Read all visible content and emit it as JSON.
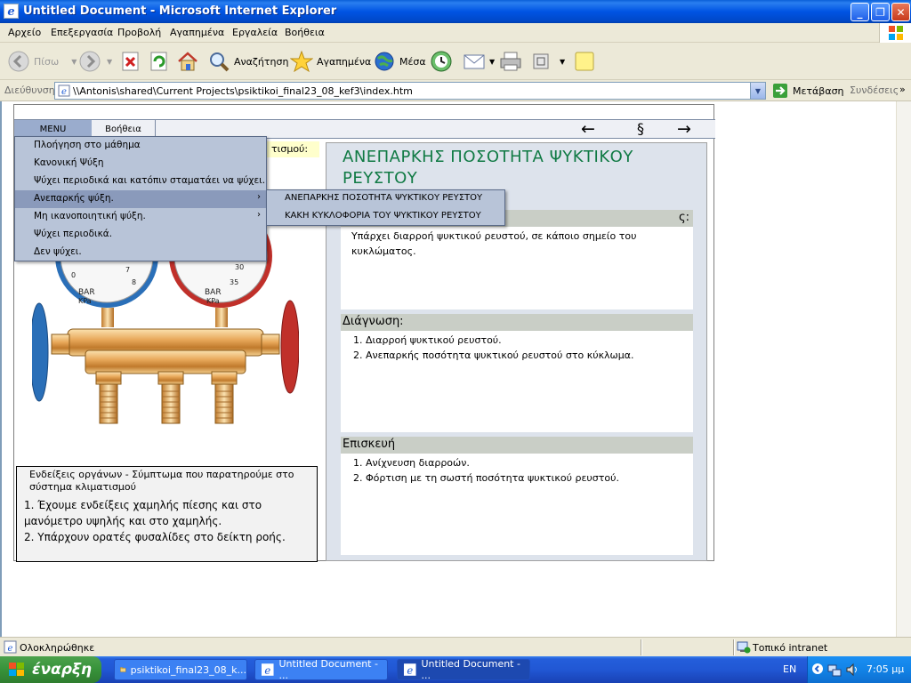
{
  "window": {
    "title": "Untitled Document - Microsoft Internet Explorer"
  },
  "menubar": [
    "Αρχείο",
    "Επεξεργασία",
    "Προβολή",
    "Αγαπημένα",
    "Εργαλεία",
    "Βοήθεια"
  ],
  "toolbar": {
    "back": "Πίσω",
    "search": "Αναζήτηση",
    "favorites": "Αγαπημένα",
    "media": "Μέσα"
  },
  "address": {
    "label": "Διεύθυνση",
    "value": "\\\\Antonis\\shared\\Current Projects\\psiktikoi_final23_08_kef3\\index.htm",
    "go": "Μετάβαση",
    "links": "Συνδέσεις"
  },
  "app": {
    "menu_tab": "MENU",
    "help_tab": "Βοήθεια",
    "nav_prev": "←",
    "nav_mid": "§",
    "nav_next": "→",
    "tip_fragment": "τισμού:",
    "main_menu": [
      "Πλοήγηση στο μάθημα",
      "Κανονική Ψύξη",
      "Ψύχει περιοδικά και κατόπιν σταματάει να ψύχει.",
      "Ανεπαρκής ψύξη.",
      "Μη ικανοποιητική  ψύξη.",
      "Ψύχει περιοδικά.",
      "Δεν ψύχει."
    ],
    "main_menu_arrow": "›",
    "sub_menu": [
      "ΑΝΕΠΑΡΚΗΣ ΠΟΣΟΤΗΤΑ ΨΥΚΤΙΚΟΥ ΡΕΥΣΤΟΥ",
      "ΚΑΚΗ ΚΥΚΛΟΦΟΡΙΑ ΤΟΥ ΨΥΚΤΙΚΟΥ ΡΕΥΣΤΟΥ"
    ],
    "gauges": {
      "left_unit": "BAR",
      "left_unit2": "KPa",
      "right_unit": "BAR",
      "right_unit2": "KPa",
      "left_nums": [
        "0",
        "7",
        "8"
      ],
      "right_nums": [
        "30",
        "35"
      ]
    },
    "instruments": {
      "title": "Ενδείξεις οργάνων - Σύμπτωμα που παρατηρούμε στο σύστημα κλιματισμού",
      "item1": "1. Έχουμε ενδείξεις χαμηλής πίεσης και στο μανόμετρο υψηλής και στο χαμηλής.",
      "item2": "2. Υπάρχουν ορατές φυσαλίδες στο δείκτη ροής."
    },
    "panel": {
      "title": "ΑΝΕΠΑΡΚΗΣ ΠΟΣΟΤΗΤΑ ΨΥΚΤΙΚΟΥ ΡΕΥΣΤΟΥ",
      "sec1_head_fragment": "ς:",
      "sec1_body": "Υπάρχει διαρροή ψυκτικού ρευστού, σε κάποιο σημείο του κυκλώματος.",
      "sec2_head": "Διάγνωση:",
      "sec2_items": [
        "Διαρροή ψυκτικού ρευστού.",
        "Ανεπαρκής ποσότητα ψυκτικού ρευστού στο κύκλωμα."
      ],
      "sec3_head": "Επισκευή",
      "sec3_items": [
        "Ανίχνευση διαρροών.",
        "Φόρτιση με τη σωστή ποσότητα ψυκτικού ρευστού."
      ]
    }
  },
  "status": {
    "text": "Ολοκληρώθηκε",
    "zone": "Τοπικό intranet"
  },
  "taskbar": {
    "start": "έναρξη",
    "tasks": [
      "psiktikoi_final23_08_k...",
      "Untitled Document - ...",
      "Untitled Document - ..."
    ],
    "lang": "EN",
    "clock": "7:05 μμ"
  },
  "colors": {
    "title_green": "#107a44",
    "menu_bg": "#b8c4d8",
    "menu_active": "#8a9abb",
    "xp_blue": "#0054e3"
  }
}
